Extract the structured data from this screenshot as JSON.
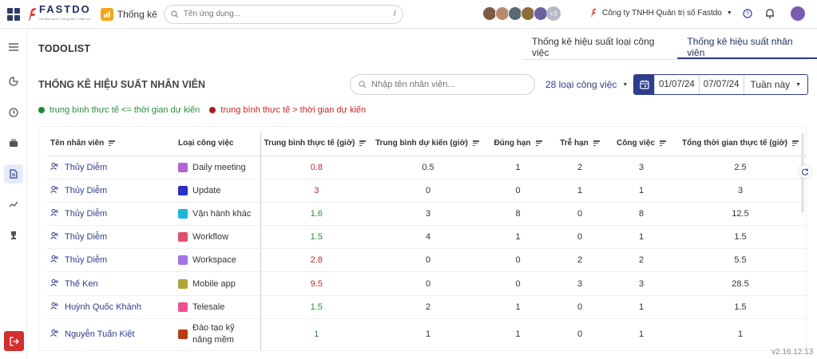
{
  "topbar": {
    "logo_text": "FASTDO",
    "logo_sub": "Hệ điều hành 1 công việc 1 nhân sự",
    "app_label": "Thống kê",
    "search_placeholder": "Tên ứng dụng...",
    "search_shortcut": "/",
    "avatars_more": "+3",
    "company": "Công ty TNHH Quản trị số Fastdo"
  },
  "header": {
    "section_title": "TODOLIST",
    "tabs": [
      {
        "label": "Thống kê hiệu suất loại công việc",
        "active": false
      },
      {
        "label": "Thống kê hiệu suất nhân viên",
        "active": true
      }
    ]
  },
  "toolbar": {
    "page_title": "THỐNG KÊ HIỆU SUẤT NHÂN VIÊN",
    "employee_search_placeholder": "Nhập tên nhân viên...",
    "task_type_filter": "28 loại công việc",
    "date_from": "01/07/24",
    "date_to": "07/07/24",
    "period": "Tuần này"
  },
  "legend": [
    {
      "label": "trung bình thực tế <= thời gian dự kiến",
      "color": "#2e8b3d"
    },
    {
      "label": "trung bình thực tế > thời gian dự kiến",
      "color": "#c62828"
    }
  ],
  "table": {
    "columns": [
      "Tên nhân viên",
      "Loại công việc",
      "Trung bình thực tế (giờ)",
      "Trung bình dự kiến (giờ)",
      "Đúng hạn",
      "Trễ hạn",
      "Công việc",
      "Tổng thời gian thực tế (giờ)"
    ],
    "rows": [
      {
        "employee": "Thủy Diễm",
        "type": "Daily meeting",
        "color": "#b463d1",
        "actual": "0.8",
        "status": "red",
        "expected": "0.5",
        "on_time": "1",
        "late": "2",
        "tasks": "3",
        "total": "2.5"
      },
      {
        "employee": "Thủy Diễm",
        "type": "Update",
        "color": "#2a2fc4",
        "actual": "3",
        "status": "red",
        "expected": "0",
        "on_time": "0",
        "late": "1",
        "tasks": "1",
        "total": "3"
      },
      {
        "employee": "Thủy Diễm",
        "type": "Vận hành khác",
        "color": "#18b7d6",
        "actual": "1.6",
        "status": "green",
        "expected": "3",
        "on_time": "8",
        "late": "0",
        "tasks": "8",
        "total": "12.5"
      },
      {
        "employee": "Thủy Diễm",
        "type": "Workflow",
        "color": "#e0526a",
        "actual": "1.5",
        "status": "green",
        "expected": "4",
        "on_time": "1",
        "late": "0",
        "tasks": "1",
        "total": "1.5"
      },
      {
        "employee": "Thủy Diễm",
        "type": "Workspace",
        "color": "#a373e8",
        "actual": "2.8",
        "status": "red",
        "expected": "0",
        "on_time": "0",
        "late": "2",
        "tasks": "2",
        "total": "5.5"
      },
      {
        "employee": "Thế Ken",
        "type": "Mobile app",
        "color": "#b0a43a",
        "actual": "9.5",
        "status": "red",
        "expected": "0",
        "on_time": "0",
        "late": "3",
        "tasks": "3",
        "total": "28.5"
      },
      {
        "employee": "Huỳnh Quốc Khánh",
        "type": "Telesale",
        "color": "#ee4f8f",
        "actual": "1.5",
        "status": "green",
        "expected": "2",
        "on_time": "1",
        "late": "0",
        "tasks": "1",
        "total": "1.5"
      },
      {
        "employee": "Nguyễn Tuấn Kiệt",
        "type": "Đào tạo kỹ năng mềm",
        "color": "#b83b15",
        "actual": "1",
        "status": "green",
        "expected": "1",
        "on_time": "1",
        "late": "0",
        "tasks": "1",
        "total": "1"
      }
    ]
  },
  "version": "v2.16.12.13"
}
